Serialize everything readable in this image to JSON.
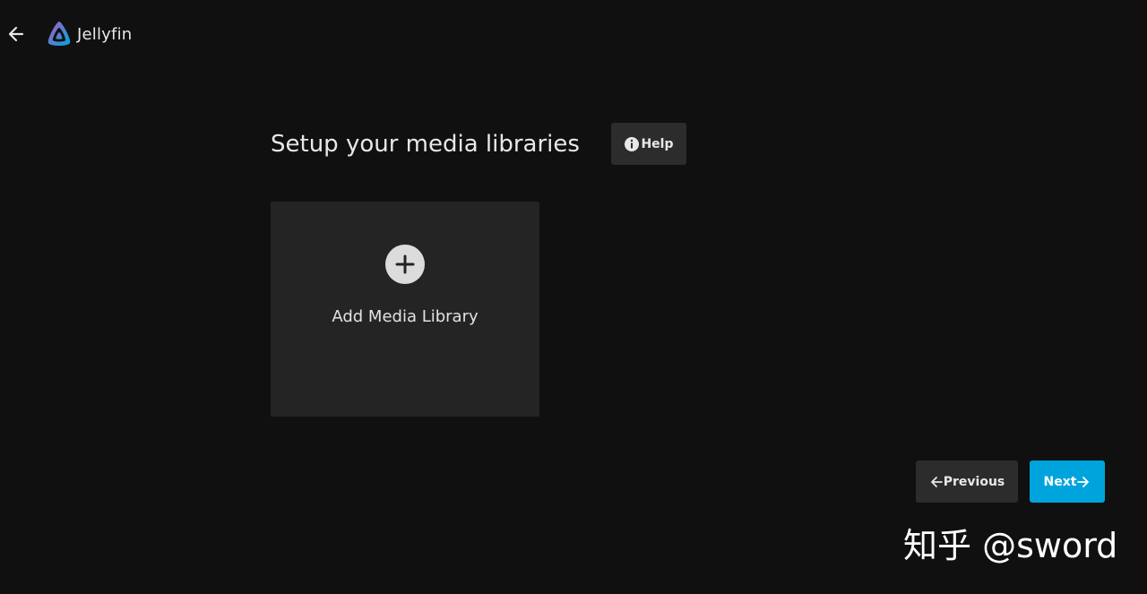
{
  "header": {
    "brand_name": "Jellyfin",
    "back_icon": "arrow-left-icon",
    "logo_icon": "jellyfin-logo-icon"
  },
  "main": {
    "title": "Setup your media libraries",
    "help_label": "Help",
    "help_icon": "info-icon",
    "add_library_label": "Add Media Library",
    "add_icon": "plus-icon"
  },
  "footer": {
    "previous_label": "Previous",
    "next_label": "Next"
  },
  "watermark": {
    "text": "知乎 @sword"
  },
  "colors": {
    "background": "#101010",
    "card": "#242424",
    "button": "#2c2c2c",
    "accent": "#00a4dc"
  }
}
